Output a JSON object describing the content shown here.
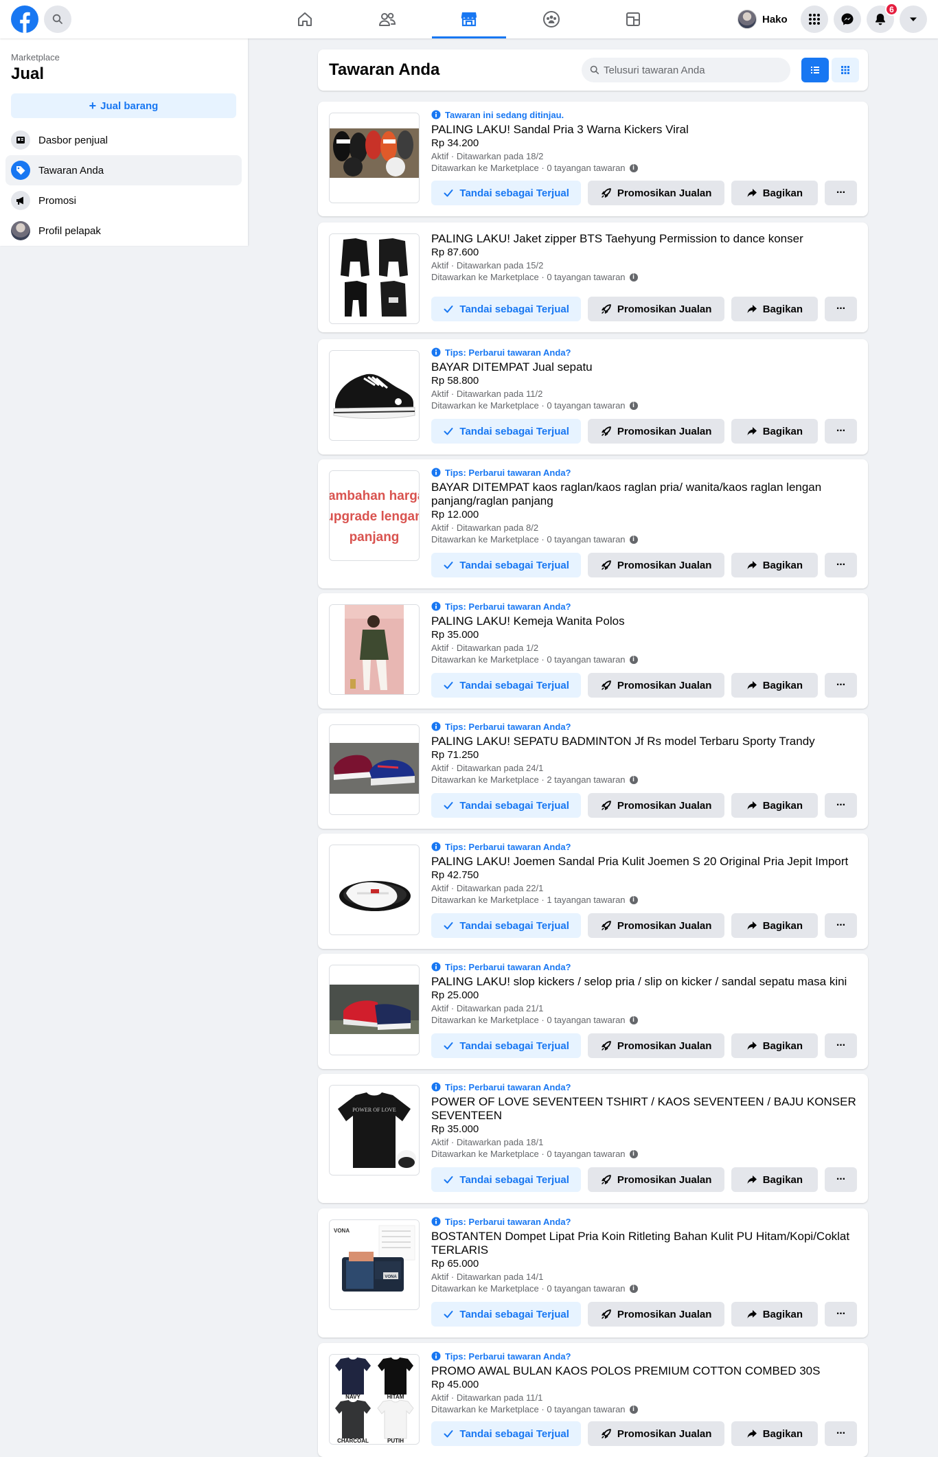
{
  "topbar": {
    "profile_name": "Hako",
    "notification_count": "6",
    "active_tab": "marketplace"
  },
  "sidebar": {
    "section_label": "Marketplace",
    "title": "Jual",
    "sell_button": "Jual barang",
    "items": [
      {
        "label": "Dasbor penjual",
        "icon": "dashboard-icon",
        "active": false
      },
      {
        "label": "Tawaran Anda",
        "icon": "tag-icon",
        "active": true
      },
      {
        "label": "Promosi",
        "icon": "megaphone-icon",
        "active": false
      },
      {
        "label": "Profil pelapak",
        "icon": "avatar-icon",
        "active": false
      }
    ]
  },
  "header": {
    "title": "Tawaran Anda",
    "search_placeholder": "Telusuri tawaran Anda",
    "view_mode": "list"
  },
  "actions": {
    "mark_sold": "Tandai sebagai Terjual",
    "promote": "Promosikan Jualan",
    "share": "Bagikan",
    "more": "···"
  },
  "colors": {
    "accent": "#1877f2",
    "accent_light": "#e7f3ff",
    "background": "#f0f2f5",
    "badge": "#e41e3f"
  },
  "listings": [
    {
      "notice": "Tawaran ini sedang ditinjau.",
      "title": "PALING LAKU! Sandal Pria 3 Warna Kickers Viral",
      "price": "Rp 34.200",
      "status": "Aktif · Ditawarkan pada 18/2",
      "views": "Ditawarkan ke Marketplace · 0 tayangan tawaran",
      "image": "sandals-three-colors"
    },
    {
      "notice": "",
      "title": "PALING LAKU! Jaket zipper BTS Taehyung Permission to dance konser",
      "price": "Rp 87.600",
      "status": "Aktif · Ditawarkan pada 15/2",
      "views": "Ditawarkan ke Marketplace · 0 tayangan tawaran",
      "image": "black-jacket"
    },
    {
      "notice": "Tips: Perbarui tawaran Anda?",
      "title": "BAYAR DITEMPAT Jual sepatu",
      "price": "Rp 58.800",
      "status": "Aktif · Ditawarkan pada 11/2",
      "views": "Ditawarkan ke Marketplace · 0 tayangan tawaran",
      "image": "black-sneaker"
    },
    {
      "notice": "Tips: Perbarui tawaran Anda?",
      "title": "BAYAR DITEMPAT kaos raglan/kaos raglan pria/ wanita/kaos raglan lengan panjang/raglan panjang",
      "price": "Rp 12.000",
      "status": "Aktif · Ditawarkan pada 8/2",
      "views": "Ditawarkan ke Marketplace · 0 tayangan tawaran",
      "image": "text-banner",
      "image_text": [
        "tambahan harga",
        "upgrade lengan",
        "panjang"
      ]
    },
    {
      "notice": "Tips: Perbarui tawaran Anda?",
      "title": "PALING LAKU! Kemeja Wanita Polos",
      "price": "Rp 35.000",
      "status": "Aktif · Ditawarkan pada 1/2",
      "views": "Ditawarkan ke Marketplace · 0 tayangan tawaran",
      "image": "woman-shirt"
    },
    {
      "notice": "Tips: Perbarui tawaran Anda?",
      "title": "PALING LAKU! SEPATU BADMINTON Jf Rs model Terbaru Sporty Trandy",
      "price": "Rp 71.250",
      "status": "Aktif · Ditawarkan pada 24/1",
      "views": "Ditawarkan ke Marketplace · 2 tayangan tawaran",
      "image": "badminton-shoes"
    },
    {
      "notice": "Tips: Perbarui tawaran Anda?",
      "title": "PALING LAKU! Joemen Sandal Pria Kulit Joemen S 20 Original Pria Jepit Import",
      "price": "Rp 42.750",
      "status": "Aktif · Ditawarkan pada 22/1",
      "views": "Ditawarkan ke Marketplace · 1 tayangan tawaran",
      "image": "slide-sandal"
    },
    {
      "notice": "Tips: Perbarui tawaran Anda?",
      "title": "PALING LAKU! slop kickers / selop pria / slip on kicker / sandal sepatu masa kini",
      "price": "Rp 25.000",
      "status": "Aktif · Ditawarkan pada 21/1",
      "views": "Ditawarkan ke Marketplace · 0 tayangan tawaran",
      "image": "slip-on-outdoor"
    },
    {
      "notice": "Tips: Perbarui tawaran Anda?",
      "title": "POWER OF LOVE SEVENTEEN TSHIRT / KAOS SEVENTEEN / BAJU KONSER SEVENTEEN",
      "price": "Rp 35.000",
      "status": "Aktif · Ditawarkan pada 18/1",
      "views": "Ditawarkan ke Marketplace · 0 tayangan tawaran",
      "image": "black-tshirt",
      "image_text": [
        "POWER OF LOVE"
      ]
    },
    {
      "notice": "Tips: Perbarui tawaran Anda?",
      "title": "BOSTANTEN Dompet Lipat Pria Koin Ritleting Bahan Kulit PU Hitam/Kopi/Coklat TERLARIS",
      "price": "Rp 65.000",
      "status": "Aktif · Ditawarkan pada 14/1",
      "views": "Ditawarkan ke Marketplace · 0 tayangan tawaran",
      "image": "wallet",
      "image_text": [
        "VONA",
        "VONA"
      ]
    },
    {
      "notice": "Tips: Perbarui tawaran Anda?",
      "title": "PROMO AWAL BULAN KAOS POLOS PREMIUM COTTON COMBED 30S",
      "price": "Rp 45.000",
      "status": "Aktif · Ditawarkan pada 11/1",
      "views": "Ditawarkan ke Marketplace · 0 tayangan tawaran",
      "image": "plain-tshirts",
      "image_text": [
        "NAVY",
        "HITAM",
        "CHARCOAL",
        "PUTIH"
      ]
    }
  ]
}
